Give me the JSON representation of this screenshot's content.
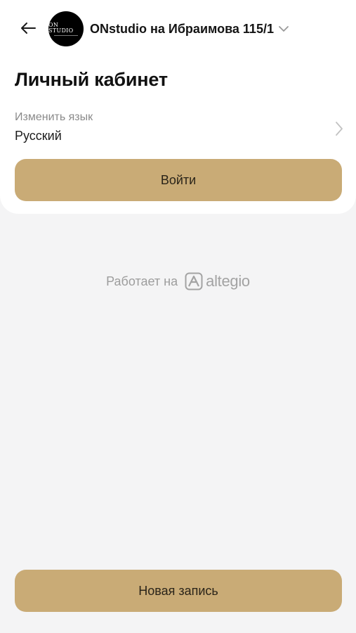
{
  "header": {
    "back_icon": "arrow-left-icon",
    "avatar_text": "ON STUDIO",
    "studio_name": "ONstudio на Ибраимова 115/1",
    "dropdown_icon": "chevron-down-icon"
  },
  "profile": {
    "title": "Личный кабинет",
    "language": {
      "label": "Изменить язык",
      "value": "Русский",
      "icon": "chevron-right-icon"
    },
    "login_label": "Войти"
  },
  "footer": {
    "powered_by": "Работает на",
    "brand": "altegio",
    "new_booking_label": "Новая запись"
  },
  "colors": {
    "accent": "#c9ab76",
    "background": "#f4f4f5",
    "card": "#ffffff"
  }
}
